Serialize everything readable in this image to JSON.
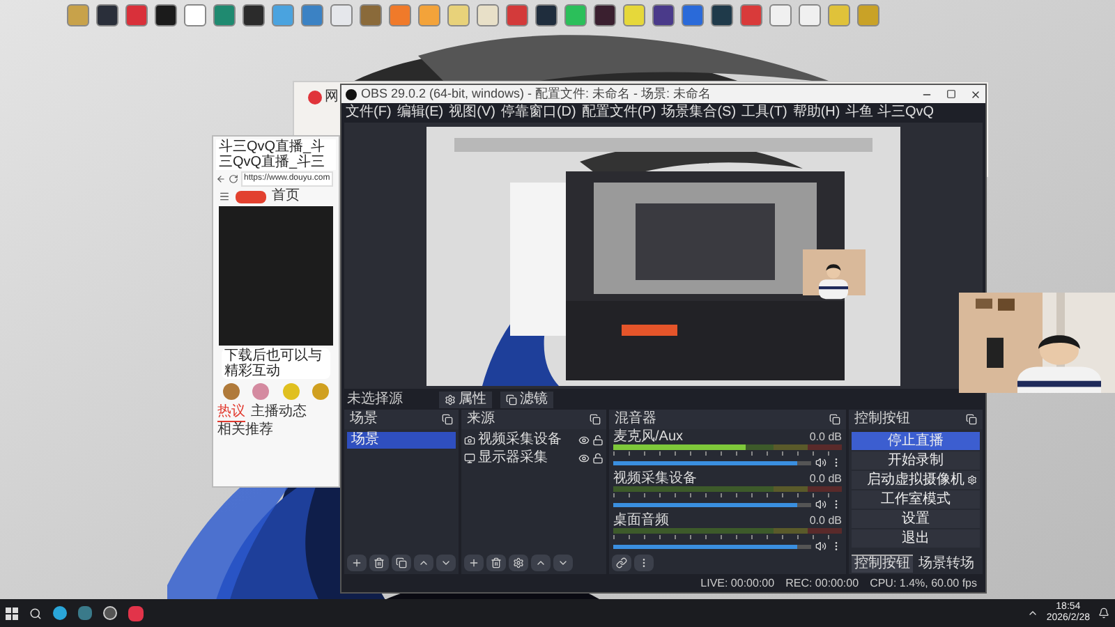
{
  "background_window": {
    "title": "网"
  },
  "browser": {
    "tab_title": "斗三QvQ直播_斗三QvQ直播_斗三",
    "url": "https://www.douyu.com",
    "nav_link": "首页",
    "banner": "下载后也可以与精彩互动",
    "tabs": [
      {
        "label": "热议",
        "selected": true
      },
      {
        "label": "主播动态",
        "selected": false
      },
      {
        "label": "相关推荐",
        "selected": false
      }
    ]
  },
  "obs": {
    "title": "OBS 29.0.2 (64-bit, windows) - 配置文件: 未命名 - 场景: 未命名",
    "menu": [
      "文件(F)",
      "编辑(E)",
      "视图(V)",
      "停靠窗口(D)",
      "配置文件(P)",
      "场景集合(S)",
      "工具(T)",
      "帮助(H)",
      "斗鱼 斗三QvQ"
    ],
    "properties_bar": {
      "label": "未选择源",
      "buttons": [
        "属性",
        "滤镜"
      ]
    },
    "scenes": {
      "title": "场景",
      "items": [
        {
          "label": "场景",
          "selected": true
        }
      ]
    },
    "sources": {
      "title": "来源",
      "items": [
        {
          "label": "视频采集设备",
          "kind": "camera",
          "visible": true,
          "locked": false
        },
        {
          "label": "显示器采集",
          "kind": "monitor",
          "visible": true,
          "locked": false
        }
      ]
    },
    "mixer": {
      "title": "混音器",
      "channels": [
        {
          "name": "麦克风/Aux",
          "reading": "0.0 dB",
          "meter": {
            "level": 0.58
          },
          "volume": {
            "level": 0.93
          }
        },
        {
          "name": "视频采集设备",
          "reading": "0.0 dB",
          "meter": {
            "level": 0.0
          },
          "volume": {
            "level": 0.93
          }
        },
        {
          "name": "桌面音频",
          "reading": "0.0 dB",
          "meter": {
            "level": 0.0
          },
          "volume": {
            "level": 0.93
          }
        }
      ]
    },
    "controls": {
      "title": "控制按钮",
      "buttons": [
        {
          "label": "停止直播",
          "active": true,
          "kind": "plain"
        },
        {
          "label": "开始录制",
          "active": false,
          "kind": "plain"
        },
        {
          "label": "启动虚拟摄像机",
          "active": false,
          "kind": "gear"
        },
        {
          "label": "工作室模式",
          "active": false,
          "kind": "plain"
        },
        {
          "label": "设置",
          "active": false,
          "kind": "plain"
        },
        {
          "label": "退出",
          "active": false,
          "kind": "plain"
        }
      ],
      "tabs": [
        {
          "label": "控制按钮",
          "selected": true
        },
        {
          "label": "场景转场",
          "selected": false
        }
      ]
    },
    "status": {
      "live": "LIVE: 00:00:00",
      "rec": "REC: 00:00:00",
      "cpu": "CPU: 1.4%, 60.00 fps"
    }
  },
  "taskbar": {
    "time": "18:54",
    "date": "2026/2/28"
  }
}
